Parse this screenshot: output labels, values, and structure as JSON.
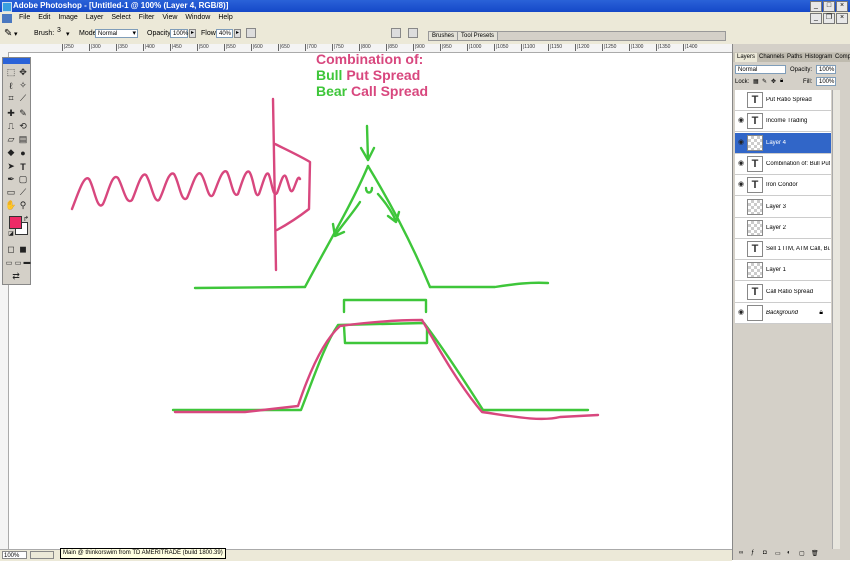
{
  "window": {
    "title": "Adobe Photoshop - [Untitled-1 @ 100% (Layer 4, RGB/8)]",
    "icons": [
      "minimize-icon",
      "maximize-icon",
      "close-icon"
    ]
  },
  "menu": [
    "File",
    "Edit",
    "Image",
    "Layer",
    "Select",
    "Filter",
    "View",
    "Window",
    "Help"
  ],
  "options": {
    "brush_label": "Brush:",
    "brush_size": "3",
    "mode_label": "Mode:",
    "mode_value": "Normal",
    "opacity_label": "Opacity:",
    "opacity_value": "100%",
    "flow_label": "Flow:",
    "flow_value": "40%",
    "palette_tabs": [
      "Brushes",
      "Tool Presets"
    ]
  },
  "ruler_ticks": [
    "|250",
    "|300",
    "|350",
    "|400",
    "|450",
    "|500",
    "|550",
    "|600",
    "|650",
    "|700",
    "|750",
    "|800",
    "|850",
    "|900",
    "|950",
    "|1000",
    "|1050",
    "|1100",
    "|1150",
    "|1200",
    "|1250",
    "|1300",
    "|1350",
    "|1400"
  ],
  "canvas": {
    "heading_line1": "Combination of:",
    "heading_line2_a": "Bull",
    "heading_line2_b": "Put Spread",
    "heading_line3_a": "Bear",
    "heading_line3_b": "Call Spread",
    "colors": {
      "pink": "#d8477e",
      "green": "#3ec63a"
    }
  },
  "toolbox": {
    "foreground_color": "#ee2a66",
    "background_color": "#ffffff"
  },
  "layers_panel": {
    "tabs": [
      "Layers",
      "Channels",
      "Paths",
      "Histogram",
      "Compo..."
    ],
    "blend_mode": "Normal",
    "opacity_label": "Opacity:",
    "opacity_value": "100%",
    "lock_label": "Lock:",
    "fill_label": "Fill:",
    "fill_value": "100%",
    "layers": [
      {
        "name": "Put Ratio Spread",
        "type": "text",
        "visible": false,
        "selected": false
      },
      {
        "name": "Income Trading",
        "type": "text",
        "visible": true,
        "selected": false
      },
      {
        "name": "Layer 4",
        "type": "raster",
        "visible": true,
        "selected": true
      },
      {
        "name": "Combination of: Bull Put S...",
        "type": "text",
        "visible": true,
        "selected": false
      },
      {
        "name": "Iron Condor",
        "type": "text",
        "visible": true,
        "selected": false
      },
      {
        "name": "Layer 3",
        "type": "raster",
        "visible": false,
        "selected": false
      },
      {
        "name": "Layer 2",
        "type": "raster",
        "visible": false,
        "selected": false
      },
      {
        "name": "Sell 1 ITM, ATM Call, Buy ...",
        "type": "text",
        "visible": false,
        "selected": false
      },
      {
        "name": "Layer 1",
        "type": "raster",
        "visible": false,
        "selected": false
      },
      {
        "name": "Call Ratio Spread",
        "type": "text",
        "visible": false,
        "selected": false
      },
      {
        "name": "Background",
        "type": "background",
        "visible": true,
        "selected": false
      }
    ]
  },
  "status": {
    "zoom": "100%",
    "taskbar_tooltip": "Main @ thinkorswim from TD AMERITRADE (build 1800.39)"
  }
}
